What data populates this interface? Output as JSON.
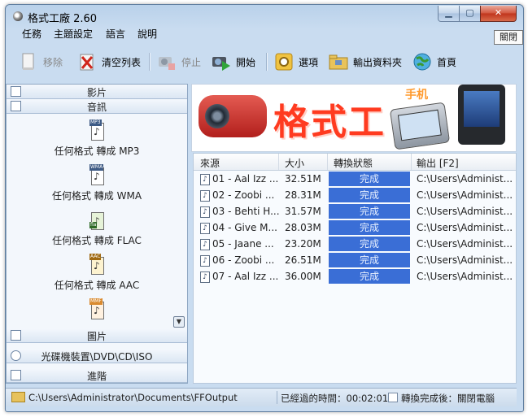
{
  "window": {
    "title": "格式工廠 2.60",
    "tooltip": "關閉"
  },
  "menu": [
    "任務",
    "主題設定",
    "語言",
    "說明"
  ],
  "toolbar": {
    "remove": "移除",
    "clear": "清空列表",
    "stop": "停止",
    "start": "開始",
    "options": "選項",
    "output_folder": "輸出資料夾",
    "home": "首頁"
  },
  "sidebar": {
    "categories": {
      "video": "影片",
      "audio": "音訊",
      "image": "圖片",
      "disc": "光碟機裝置\\DVD\\CD\\ISO",
      "advanced": "進階"
    },
    "formats": [
      {
        "tag": "MP3",
        "label": "任何格式 轉成 MP3"
      },
      {
        "tag": "WMA",
        "label": "任何格式 轉成 WMA"
      },
      {
        "tag": "fla",
        "label": "任何格式 轉成 FLAC"
      },
      {
        "tag": "AAC",
        "label": "任何格式 轉成 AAC"
      },
      {
        "tag": "MMF",
        "label": ""
      }
    ]
  },
  "banner": {
    "brand": "格式工",
    "tag": "手机"
  },
  "table": {
    "headers": {
      "source": "來源",
      "size": "大小",
      "status": "轉換狀態",
      "output": "輸出 [F2]"
    },
    "rows": [
      {
        "source": "01 - Aal Izz ...",
        "size": "32.51M",
        "status": "完成",
        "output": "C:\\Users\\Administ..."
      },
      {
        "source": "02 - Zoobi ...",
        "size": "28.31M",
        "status": "完成",
        "output": "C:\\Users\\Administ..."
      },
      {
        "source": "03 - Behti H...",
        "size": "31.57M",
        "status": "完成",
        "output": "C:\\Users\\Administ..."
      },
      {
        "source": "04 - Give M...",
        "size": "28.03M",
        "status": "完成",
        "output": "C:\\Users\\Administ..."
      },
      {
        "source": "05 - Jaane ...",
        "size": "23.20M",
        "status": "完成",
        "output": "C:\\Users\\Administ..."
      },
      {
        "source": "06 - Zoobi ...",
        "size": "26.51M",
        "status": "完成",
        "output": "C:\\Users\\Administ..."
      },
      {
        "source": "07 - Aal Izz ...",
        "size": "36.00M",
        "status": "完成",
        "output": "C:\\Users\\Administ..."
      }
    ]
  },
  "statusbar": {
    "path": "C:\\Users\\Administrator\\Documents\\FFOutput",
    "elapsed": "已經過的時間：00:02:01",
    "after": "轉換完成後：關閉電腦"
  }
}
